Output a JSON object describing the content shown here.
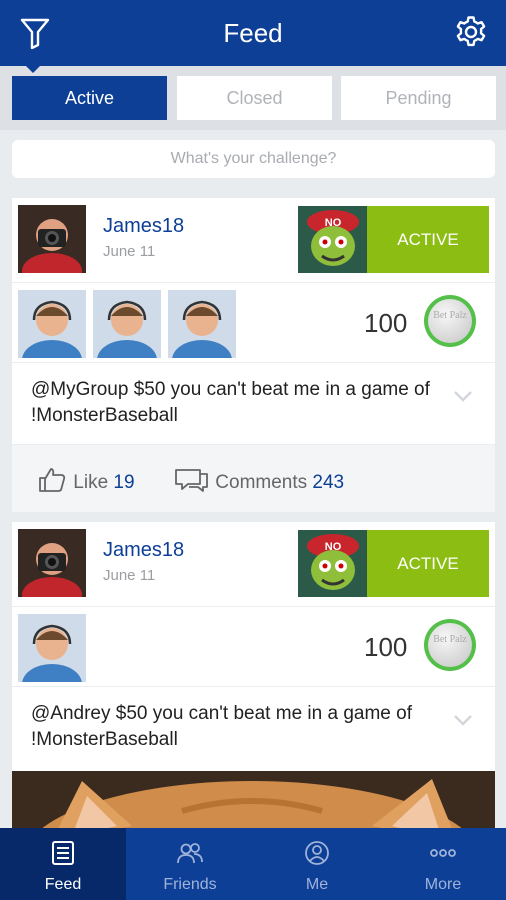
{
  "header": {
    "title": "Feed",
    "filter_icon": "filter-icon",
    "settings_icon": "gear-icon"
  },
  "segments": [
    {
      "label": "Active",
      "selected": true
    },
    {
      "label": "Closed",
      "selected": false
    },
    {
      "label": "Pending",
      "selected": false
    }
  ],
  "challenge": {
    "placeholder": "What's your challenge?"
  },
  "posts": [
    {
      "user": "James18",
      "date": "June 11",
      "status": "ACTIVE",
      "points": "100",
      "coin_text": "Bet Palz",
      "message": "@MyGroup $50 you can't beat me in a game of !MonsterBaseball",
      "friends_count": 3,
      "like_label": "Like",
      "like_count": "19",
      "comments_label": "Comments",
      "comments_count": "243"
    },
    {
      "user": "James18",
      "date": "June 11",
      "status": "ACTIVE",
      "points": "100",
      "coin_text": "Bet Palz",
      "message": "@Andrey $50 you can't beat me in a game of !MonsterBaseball",
      "friends_count": 1
    }
  ],
  "tabbar": [
    {
      "label": "Feed",
      "icon": "feed-icon",
      "selected": true
    },
    {
      "label": "Friends",
      "icon": "friends-icon",
      "selected": false
    },
    {
      "label": "Me",
      "icon": "me-icon",
      "selected": false
    },
    {
      "label": "More",
      "icon": "more-icon",
      "selected": false
    }
  ],
  "colors": {
    "brand": "#0d3f96",
    "active_status": "#8bbd13",
    "coin_ring": "#54c04a"
  }
}
